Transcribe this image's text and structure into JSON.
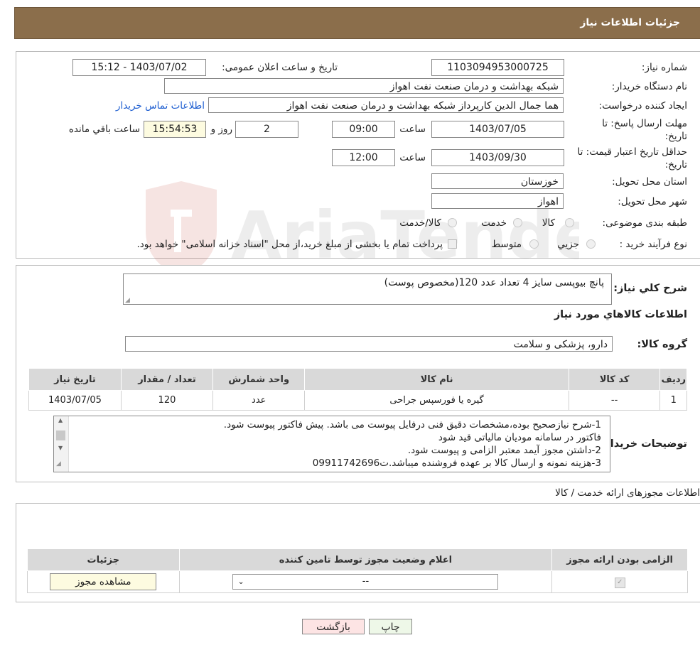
{
  "header": {
    "title": "جزئیات اطلاعات نیاز"
  },
  "form": {
    "need_number_label": "شماره نیاز:",
    "need_number": "1103094953000725",
    "announce_label": "تاریخ و ساعت اعلان عمومی:",
    "announce_value": "1403/07/02 - 15:12",
    "buyer_org_label": "نام دستگاه خریدار:",
    "buyer_org": "شبکه بهداشت و درمان صنعت نفت اهواز",
    "creator_label": "ایجاد کننده درخواست:",
    "creator": "هما جمال الدین کارپرداز شبکه بهداشت و درمان صنعت نفت اهواز",
    "contact_link": "اطلاعات تماس خریدار",
    "deadline_label_1": "مهلت ارسال پاسخ: تا",
    "deadline_label_2": "تاریخ:",
    "deadline_date": "1403/07/05",
    "time_label": "ساعت",
    "deadline_time": "09:00",
    "days_value": "2",
    "days_label": "روز و",
    "remaining_time": "15:54:53",
    "remaining_label": "ساعت باقي مانده",
    "validity_label_1": "حداقل تاریخ اعتبار قیمت: تا",
    "validity_label_2": "تاریخ:",
    "validity_date": "1403/09/30",
    "validity_time": "12:00",
    "province_label": "استان محل تحویل:",
    "province": "خوزستان",
    "city_label": "شهر محل تحویل:",
    "city": "اهواز",
    "category_label": "طبقه بندی موضوعی:",
    "category_options": [
      "کالا",
      "خدمت",
      "کالا/خدمت"
    ],
    "process_label": "نوع فرآیند خرید :",
    "process_options": [
      "جزیي",
      "متوسط"
    ],
    "process_note": "پرداخت تمام یا بخشی از مبلغ خرید،از محل \"اسناد خزانه اسلامی\" خواهد بود."
  },
  "watermark": {
    "text": "AriaTender.neT"
  },
  "summary": {
    "label": "شرح كلي نياز:",
    "text": "پانچ بیوپسی سایز 4 تعداد عدد 120(مخصوص پوست)",
    "goods_title": "اطلاعات كالاهاي مورد نياز",
    "group_label": "گروه کالا:",
    "group_value": "دارو، پزشکی و سلامت"
  },
  "items_table": {
    "headers": [
      "رديف",
      "کد کالا",
      "نام کالا",
      "واحد شمارش",
      "تعداد / مقدار",
      "تاریخ نیاز"
    ],
    "rows": [
      [
        "1",
        "--",
        "گیره یا فورسپس جراحی",
        "عدد",
        "120",
        "1403/07/05"
      ]
    ]
  },
  "notes": {
    "label": "توضیحات خریدار:",
    "lines": [
      "1-شرح نیازصحیح بوده،مشخصات دقیق فنی درفایل پیوست می باشد. پیش فاکتور پیوست شود.",
      "فاکتور در سامانه مودیان مالیاتی قید شود",
      "2-داشتن مجوز آیمد معتبر الزامی و پیوست شود.",
      "3-هزینه  نمونه و ارسال کالا بر عهده فروشنده میباشد.ت09911742696"
    ]
  },
  "permits": {
    "title": "اطلاعات مجوزهای ارائه خدمت / کالا",
    "headers": [
      "الزامی بودن ارائه مجوز",
      "اعلام وضعیت مجوز توسط تامین کننده",
      "جزئیات"
    ],
    "select_value": "--",
    "view_button": "مشاهده مجوز"
  },
  "actions": {
    "print": "چاپ",
    "back": "بازگشت"
  }
}
